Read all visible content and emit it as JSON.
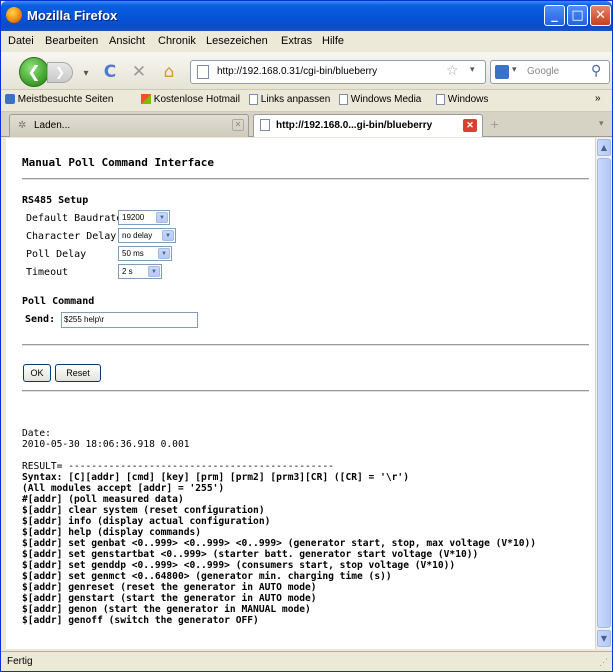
{
  "window": {
    "title": "Mozilla Firefox"
  },
  "menu": [
    "Datei",
    "Bearbeiten",
    "Ansicht",
    "Chronik",
    "Lesezeichen",
    "Extras",
    "Hilfe"
  ],
  "nav": {
    "url": "http://192.168.0.31/cgi-bin/blueberry",
    "search_placeholder": "Google"
  },
  "bookmarks": [
    "Meistbesuchte Seiten",
    "Kostenlose Hotmail",
    "Links anpassen",
    "Windows Media",
    "Windows"
  ],
  "tabs": [
    {
      "label": "Laden..."
    },
    {
      "label": "http://192.168.0...gi-bin/blueberry"
    }
  ],
  "page": {
    "title": "Manual Poll Command Interface",
    "rs485_heading": "RS485 Setup",
    "fields": [
      {
        "label": "Default Baudrate",
        "value": "19200"
      },
      {
        "label": "Character Delay",
        "value": "no delay"
      },
      {
        "label": "Poll Delay",
        "value": "50 ms"
      },
      {
        "label": "Timeout",
        "value": "2 s"
      }
    ],
    "poll_heading": "Poll Command",
    "send_label": "Send:",
    "send_value": "$255 help\\r",
    "ok_label": "OK",
    "reset_label": "Reset",
    "date_label": "Date:",
    "date_value": "2010-05-30 18:06:36.918 0.001",
    "result_line": "RESULT= ----------------------------------------------",
    "result_lines": [
      "Syntax: [C][addr] [cmd] [key] [prm] [prm2] [prm3][CR] ([CR] = '\\r')",
      "(All modules accept [addr] = '255')",
      "#[addr] (poll measured data)",
      "$[addr] clear system (reset configuration)",
      "$[addr] info (display actual configuration)",
      "$[addr] help (display commands)",
      "$[addr] set genbat <0..999> <0..999> <0..999> (generator start, stop, max voltage (V*10))",
      "$[addr] set genstartbat <0..999> (starter batt. generator start voltage (V*10))",
      "$[addr] set genddp <0..999> <0..999> (consumers start, stop voltage (V*10))",
      "$[addr] set genmct <0..64800> (generator min. charging time (s))",
      "$[addr] genreset (reset the generator in AUTO mode)",
      "$[addr] genstart (start the generator in AUTO mode)",
      "$[addr] genon (start the generator in MANUAL mode)",
      "$[addr] genoff (switch the generator OFF)"
    ]
  },
  "status": {
    "text": "Fertig"
  }
}
